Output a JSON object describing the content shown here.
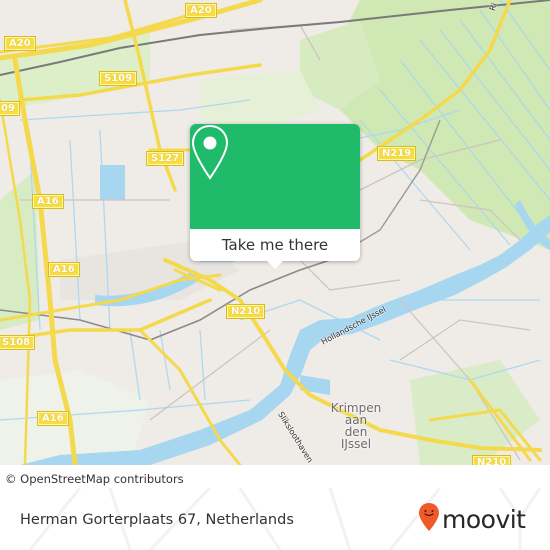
{
  "map": {
    "road_labels": [
      {
        "id": "a20-west",
        "text": "A20"
      },
      {
        "id": "a20-top",
        "text": "A20"
      },
      {
        "id": "s109",
        "text": "S109"
      },
      {
        "id": "s109-edge",
        "text": "09"
      },
      {
        "id": "s127",
        "text": "S127"
      },
      {
        "id": "a16-north",
        "text": "A16"
      },
      {
        "id": "a16-mid",
        "text": "A16"
      },
      {
        "id": "a16-south",
        "text": "A16"
      },
      {
        "id": "s108",
        "text": "S108"
      },
      {
        "id": "n210-center",
        "text": "N210"
      },
      {
        "id": "n219",
        "text": "N219"
      },
      {
        "id": "n210-east",
        "text": "N210"
      }
    ],
    "place_labels": [
      {
        "id": "krimpen",
        "lines": [
          "Krimpen",
          "aan",
          "den",
          "IJssel"
        ]
      }
    ],
    "water_labels": [
      {
        "id": "hollandsche-ijssel",
        "text": "Hollandsche IJssel"
      },
      {
        "id": "sliksloothaven",
        "text": "Sliksloothaven"
      },
      {
        "id": "ring-edge",
        "text": "Ri"
      }
    ],
    "attribution": "© OpenStreetMap contributors"
  },
  "popup": {
    "icon": "location-pin-icon",
    "button_label": "Take me there",
    "color": "#1fba6a"
  },
  "footer": {
    "address": "Herman Gorterplaats 67, Netherlands",
    "brand": "moovit",
    "brand_icon": "moovit-smiley-pin-icon",
    "brand_color": "#f05a28"
  }
}
